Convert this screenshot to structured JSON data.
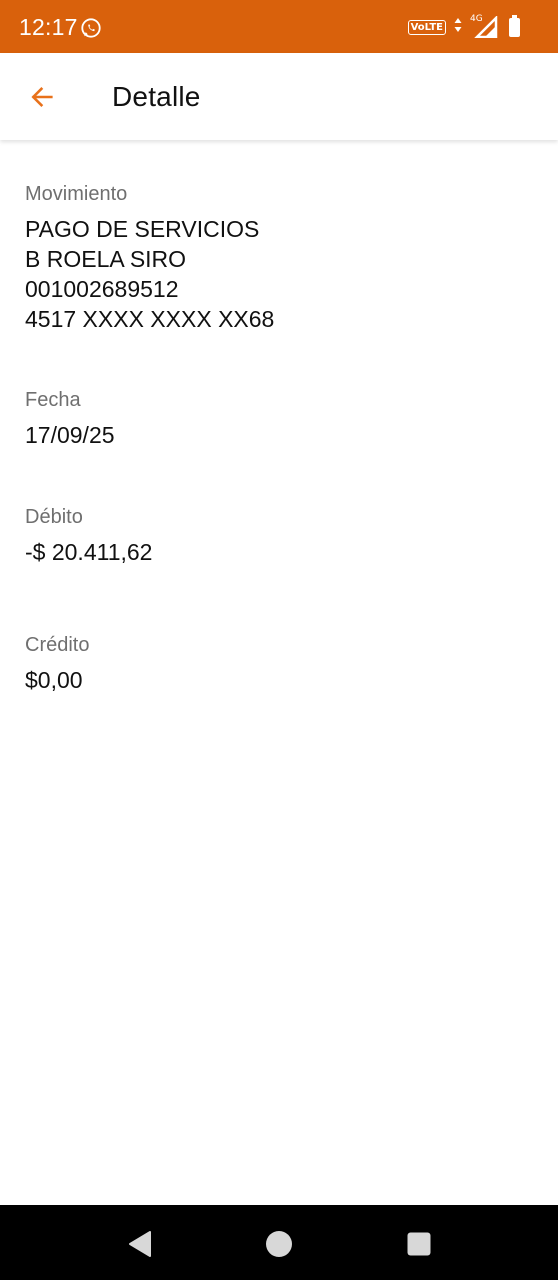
{
  "status_bar": {
    "time": "12:17",
    "volte_label": "VoLTE",
    "network_label": "4G",
    "background_color": "#d9610c"
  },
  "app_bar": {
    "title": "Detalle",
    "back_icon": "arrow-left-icon",
    "accent_color": "#e8711a"
  },
  "detail": {
    "movimiento": {
      "label": "Movimiento",
      "lines": [
        "PAGO DE SERVICIOS",
        "B ROELA SIRO",
        "001002689512",
        "4517 XXXX XXXX XX68"
      ]
    },
    "fecha": {
      "label": "Fecha",
      "value": "17/09/25"
    },
    "debito": {
      "label": "Débito",
      "value": "-$ 20.411,62"
    },
    "credito": {
      "label": "Crédito",
      "value": "$0,00"
    }
  },
  "nav_bar": {
    "back_icon": "triangle-back-icon",
    "home_icon": "circle-home-icon",
    "recents_icon": "square-recents-icon"
  }
}
